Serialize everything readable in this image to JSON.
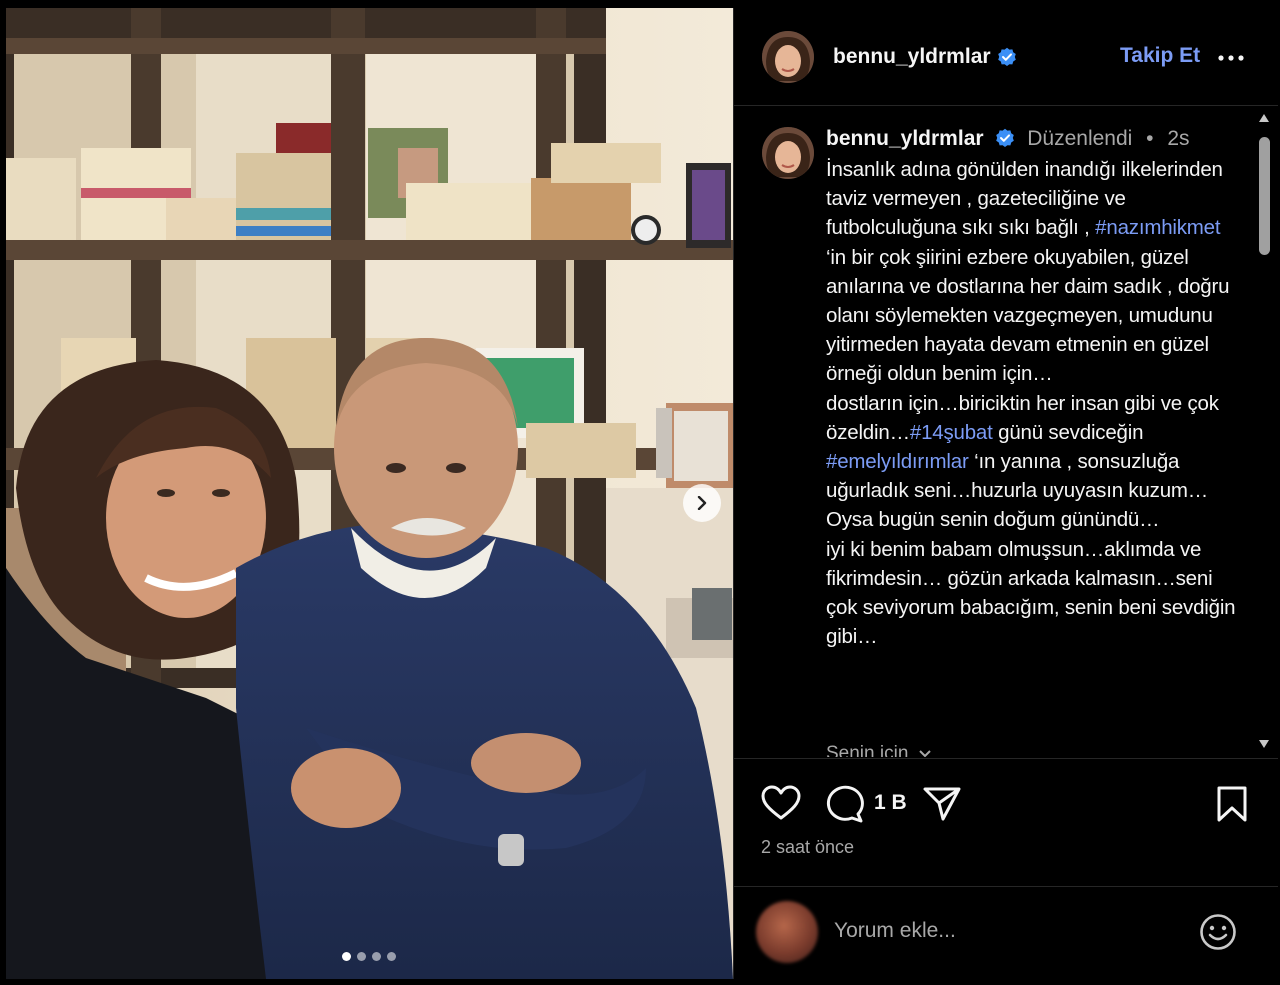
{
  "post": {
    "username": "bennu_yldrmlar",
    "follow_label": "Takip Et",
    "edited_label": "Düzenlendi",
    "separator": "•",
    "relative_time": "2s",
    "caption_part1": "İnsanlık adına gönülden inandığı ilkelerinden taviz vermeyen , gazeteciliğine ve futbolculuğuna sıkı sıkı bağlı , ",
    "hashtag1": "#nazımhikmet",
    "caption_part2": " ‘in bir çok şiirini ezbere okuyabilen, güzel anılarına ve dostlarına her daim sadık , doğru olanı söylemekten vazgeçmeyen, umudunu yitirmeden hayata devam etmenin en güzel örneği oldun benim için…\ndostların için…biriciktin her insan gibi ve çok özeldin…",
    "hashtag2": "#14şubat",
    "caption_part3": " günü sevdiceğin\n",
    "hashtag3": "#emelyıldırımlar",
    "caption_part4": " ‘ın yanına , sonsuzluğa uğurladık seni…huzurla uyuyasın kuzum…\nOysa bugün senin doğum günündü…\niyi ki benim babam olmuşsun…aklımda ve fikrimdesin… gözün arkada kalmasın…seni çok seviyorum babacığım, senin beni sevdiğin gibi…",
    "for_you_label": "Senin için",
    "comment_count": "1 B",
    "post_time": "2 saat önce",
    "comment_placeholder": "Yorum ekle...",
    "carousel": {
      "total": 4,
      "active": 1
    }
  },
  "icons": {
    "verified": "verified-badge-icon",
    "more": "more-options-icon",
    "like": "heart-icon",
    "comment": "comment-icon",
    "share": "share-icon",
    "save": "bookmark-icon",
    "emoji": "emoji-icon",
    "next": "chevron-right-icon",
    "dropdown": "chevron-down-icon"
  },
  "colors": {
    "background": "#000000",
    "link": "#7c9cf5",
    "secondary_text": "#a8a8a8",
    "verified": "#3b8ff6"
  }
}
